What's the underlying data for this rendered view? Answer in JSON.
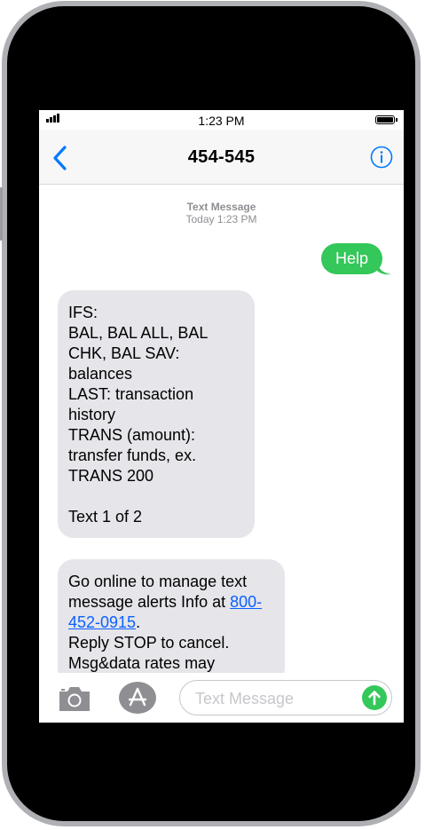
{
  "status_bar": {
    "time": "1:23 PM"
  },
  "nav": {
    "title": "454-545"
  },
  "thread": {
    "service": "Text Message",
    "timestamp": "Today 1:23 PM",
    "messages": [
      {
        "direction": "outgoing",
        "text": "Help"
      },
      {
        "direction": "incoming",
        "text": "IFS:\nBAL, BAL ALL, BAL CHK, BAL SAV: balances\nLAST: transaction history\nTRANS (amount): transfer funds, ex. TRANS 200\n\nText 1 of 2"
      },
      {
        "direction": "incoming",
        "text_before_link": "Go online to manage text message alerts Info at ",
        "link": "800-452-0915",
        "text_after_link": ".\nReply STOP to cancel. Msg&data rates may"
      }
    ]
  },
  "input": {
    "placeholder": "Text Message"
  },
  "colors": {
    "accent_blue": "#007aff",
    "outgoing_green": "#34c759",
    "incoming_gray": "#e5e5ea"
  },
  "icons": {
    "back": "chevron-left",
    "info": "info-circle",
    "camera": "camera",
    "apps": "app-store",
    "send": "arrow-up"
  }
}
